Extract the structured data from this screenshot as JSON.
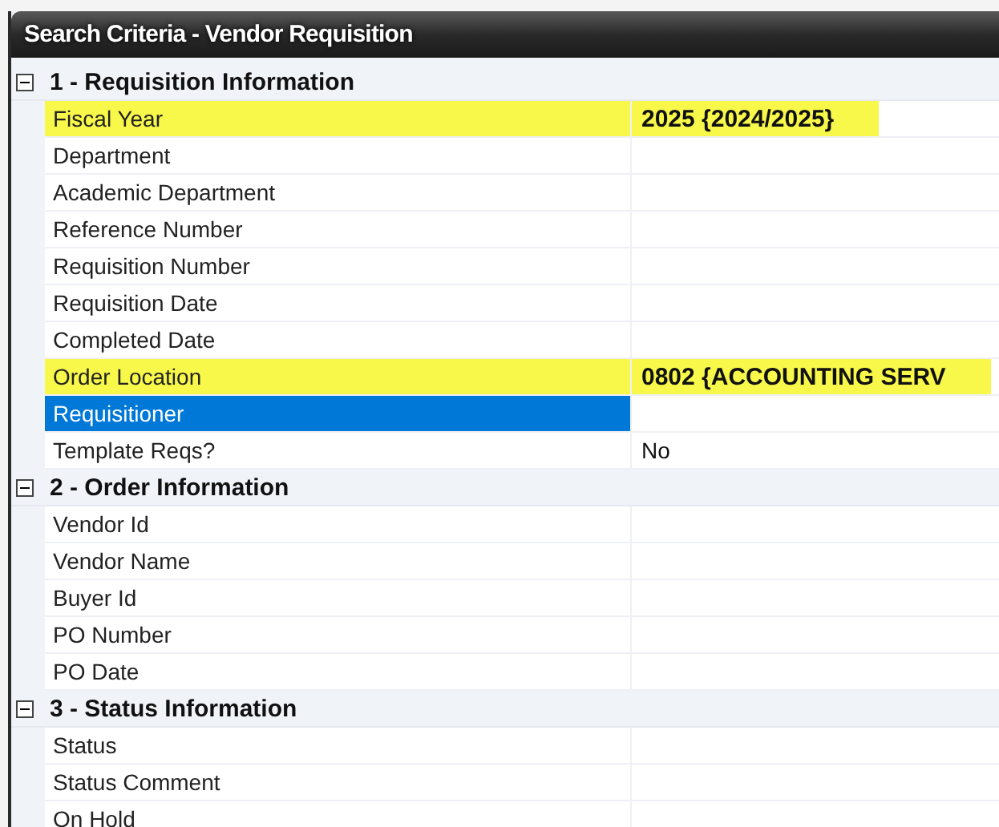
{
  "window": {
    "title": "Search Criteria - Vendor Requisition"
  },
  "sections": [
    {
      "title": "1 - Requisition Information",
      "expanded": true,
      "fields": [
        {
          "label": "Fiscal Year",
          "value": "2025 {2024/2025}",
          "highlighted": true,
          "selected": false
        },
        {
          "label": "Department",
          "highlighted": false,
          "selected": false
        },
        {
          "label": "Academic Department",
          "highlighted": false,
          "selected": false
        },
        {
          "label": "Reference Number",
          "highlighted": false,
          "selected": false
        },
        {
          "label": "Requisition Number",
          "highlighted": false,
          "selected": false
        },
        {
          "label": "Requisition Date",
          "highlighted": false,
          "selected": false
        },
        {
          "label": "Completed Date",
          "highlighted": false,
          "selected": false
        },
        {
          "label": "Order Location",
          "value": "0802 {ACCOUNTING SERV",
          "highlighted": true,
          "selected": false
        },
        {
          "label": "Requisitioner",
          "highlighted": false,
          "selected": true
        },
        {
          "label": "Template Reqs?",
          "value": "No",
          "highlighted": false,
          "selected": false
        }
      ]
    },
    {
      "title": "2 - Order Information",
      "expanded": true,
      "fields": [
        {
          "label": "Vendor Id",
          "highlighted": false,
          "selected": false
        },
        {
          "label": "Vendor Name",
          "highlighted": false,
          "selected": false
        },
        {
          "label": "Buyer Id",
          "highlighted": false,
          "selected": false
        },
        {
          "label": "PO Number",
          "highlighted": false,
          "selected": false
        },
        {
          "label": "PO Date",
          "highlighted": false,
          "selected": false
        }
      ]
    },
    {
      "title": "3 - Status Information",
      "expanded": true,
      "fields": [
        {
          "label": "Status",
          "highlighted": false,
          "selected": false
        },
        {
          "label": "Status Comment",
          "highlighted": false,
          "selected": false
        },
        {
          "label": "On Hold",
          "highlighted": false,
          "selected": false
        }
      ]
    }
  ]
}
